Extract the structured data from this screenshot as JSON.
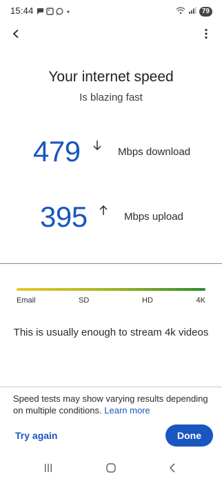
{
  "status_bar": {
    "time": "15:44",
    "battery": "79",
    "left_icons": [
      "chat-icon",
      "image-icon",
      "whatsapp-icon",
      "dot-icon"
    ],
    "right_icons": [
      "wifi-icon",
      "signal-icon",
      "battery-icon"
    ]
  },
  "top_bar": {
    "back_icon": "back-arrow-icon",
    "more_icon": "more-vertical-icon"
  },
  "result": {
    "title": "Your internet speed",
    "subtitle": "Is blazing fast",
    "download_value": "479",
    "download_unit": "Mbps download",
    "upload_value": "395",
    "upload_unit": "Mbps upload"
  },
  "quality_scale": {
    "labels": [
      "Email",
      "SD",
      "HD",
      "4K"
    ],
    "colors": [
      "#e9c82c",
      "#a9b81f",
      "#2f8a2f"
    ]
  },
  "verdict": "This is usually enough to stream 4k videos",
  "footer": {
    "disclaimer": "Speed tests may show varying results depending on multiple conditions.",
    "learn_more": "Learn more",
    "try_again": "Try again",
    "done": "Done"
  },
  "nav_bar": {
    "icons": [
      "recent-apps-icon",
      "home-icon",
      "back-icon"
    ]
  },
  "colors": {
    "accent": "#1a56c0",
    "text": "#1f1f1f",
    "background": "#ffffff"
  }
}
